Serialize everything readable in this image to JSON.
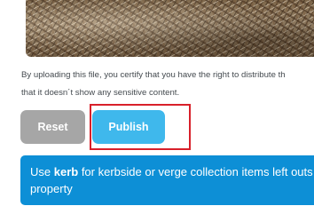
{
  "preview": {
    "alt": "Uploaded photo of a pile of woody garden waste and branches"
  },
  "notice": {
    "line1": "By uploading this file, you certify that you have the right to distribute th",
    "line2": "that it doesn´t show any sensitive content."
  },
  "buttons": {
    "reset_label": "Reset",
    "publish_label": "Publish"
  },
  "info": {
    "prefix": "Use ",
    "keyword": "kerb",
    "suffix": " for kerbside or verge collection items left outs",
    "line2": "property"
  },
  "colors": {
    "reset_bg": "#a6a6a6",
    "publish_bg": "#3fb8ec",
    "info_bg": "#0d8fd6",
    "highlight_border": "#d8202a"
  }
}
